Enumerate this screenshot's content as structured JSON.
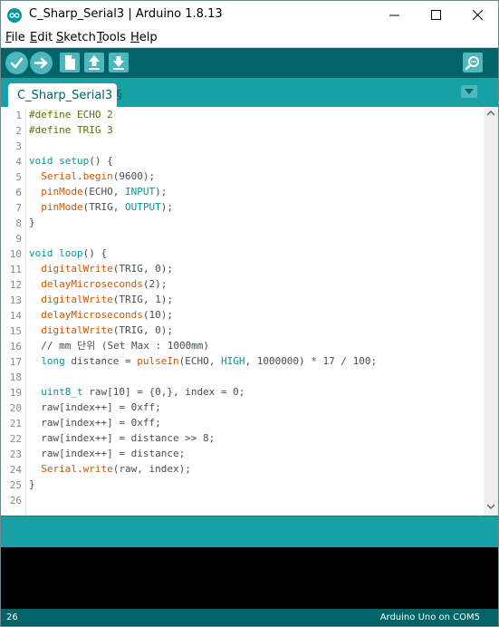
{
  "window": {
    "title": "C_Sharp_Serial3 | Arduino 1.8.13",
    "controls": {
      "minimize": "minimize-icon",
      "maximize": "maximize-icon",
      "close": "close-icon"
    }
  },
  "menu": [
    {
      "pre": "",
      "key": "F",
      "rest": "ile"
    },
    {
      "pre": "",
      "key": "E",
      "rest": "dit"
    },
    {
      "pre": "",
      "key": "S",
      "rest": "ketch"
    },
    {
      "pre": "",
      "key": "T",
      "rest": "ools"
    },
    {
      "pre": "",
      "key": "H",
      "rest": "elp"
    }
  ],
  "toolbar": {
    "buttons": [
      "verify-icon",
      "upload-icon",
      "new-icon",
      "open-icon",
      "save-icon"
    ],
    "right": "serial-monitor-icon"
  },
  "tabs": [
    {
      "label": "C_Sharp_Serial3 §"
    }
  ],
  "tab_menu_icon": "chevron-down-icon",
  "editor": {
    "lines": [
      "#define ECHO 2",
      "#define TRIG 3",
      "",
      "void setup() {",
      "  Serial.begin(9600);",
      "  pinMode(ECHO, INPUT);",
      "  pinMode(TRIG, OUTPUT);",
      "}",
      "",
      "void loop() {",
      "  digitalWrite(TRIG, 0);",
      "  delayMicroseconds(2);",
      "  digitalWrite(TRIG, 1);",
      "  delayMicroseconds(10);",
      "  digitalWrite(TRIG, 0);",
      "  // mm 단위 (Set Max : 1000mm)",
      "  long distance = pulseIn(ECHO, HIGH, 1000000) * 17 / 100;",
      "",
      "  uint8_t raw[10] = {0,}, index = 0;",
      "  raw[index++] = 0xff;",
      "  raw[index++] = 0xff;",
      "  raw[index++] = distance >> 8;",
      "  raw[index++] = distance;",
      "  Serial.write(raw, index);",
      "}",
      ""
    ]
  },
  "status": {
    "line": "26",
    "board": "Arduino Uno on COM5"
  },
  "colors": {
    "toolbar": "#006468",
    "tabbar": "#17a1a5",
    "button": "#4db7bb",
    "keyword": "#00979c",
    "function": "#d35400",
    "preprocessor": "#5e6d03",
    "console": "#000000"
  }
}
